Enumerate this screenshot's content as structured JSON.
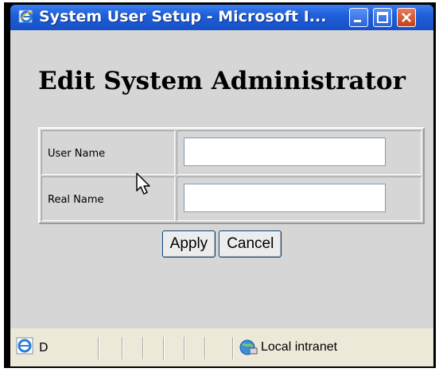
{
  "window": {
    "title": "System User Setup - Microsoft I...",
    "icon": "ie-icon"
  },
  "page": {
    "title": "Edit System Administrator"
  },
  "form": {
    "fields": [
      {
        "label": "User Name",
        "value": ""
      },
      {
        "label": "Real Name",
        "value": ""
      }
    ]
  },
  "buttons": {
    "apply": "Apply",
    "cancel": "Cancel"
  },
  "statusbar": {
    "text": "D",
    "zone": "Local intranet"
  },
  "colors": {
    "titlebar": "#1f5fd8",
    "content_bg": "#d6d6d6",
    "statusbar_bg": "#ece9d8"
  }
}
